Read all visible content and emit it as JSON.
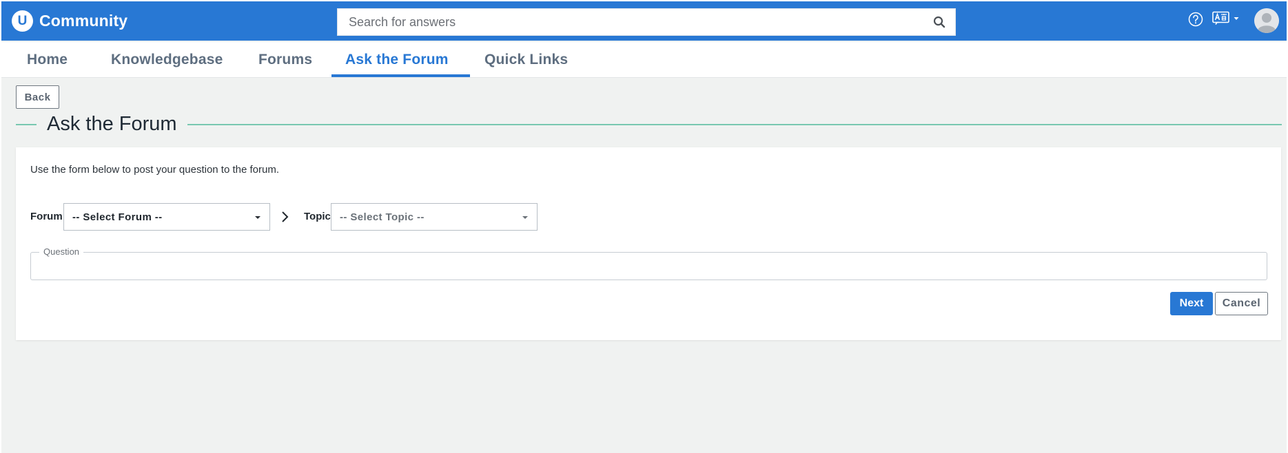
{
  "header": {
    "brand_logo_letter": "U",
    "brand_name": "Community",
    "search_placeholder": "Search for answers",
    "icons": [
      "search-icon",
      "help-icon",
      "translate-icon",
      "avatar-icon"
    ],
    "accent_color": "#2878d4"
  },
  "nav": {
    "items": [
      {
        "label": "Home",
        "active": false
      },
      {
        "label": "Knowledgebase",
        "active": false
      },
      {
        "label": "Forums",
        "active": false
      },
      {
        "label": "Ask the Forum",
        "active": true
      },
      {
        "label": "Quick Links",
        "active": false
      }
    ]
  },
  "page": {
    "back_label": "Back",
    "title": "Ask the Forum",
    "title_rule_color": "#78c8b0"
  },
  "form": {
    "intro": "Use the form below to post your question to the forum.",
    "forum_label": "Forum",
    "forum_value": "-- Select Forum --",
    "topic_label": "Topic",
    "topic_value": "-- Select Topic --",
    "question_label": "Question",
    "question_value": "",
    "next_label": "Next",
    "cancel_label": "Cancel"
  }
}
